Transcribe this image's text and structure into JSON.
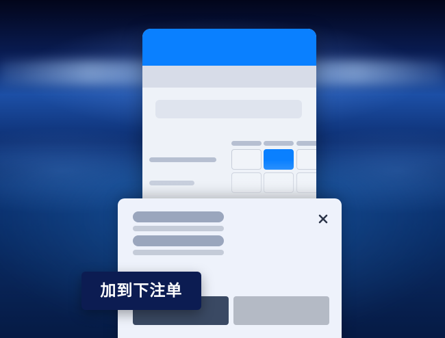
{
  "background": {
    "description_colors": {
      "deep": "#02051a",
      "mid": "#1c4fa6",
      "glow": "#bcd8ff"
    }
  },
  "bet_card": {
    "accent_color": "#0a80ff"
  },
  "bet_slip_popup": {
    "add_to_slip_label": "加到下注单",
    "close_icon": "close-icon"
  }
}
